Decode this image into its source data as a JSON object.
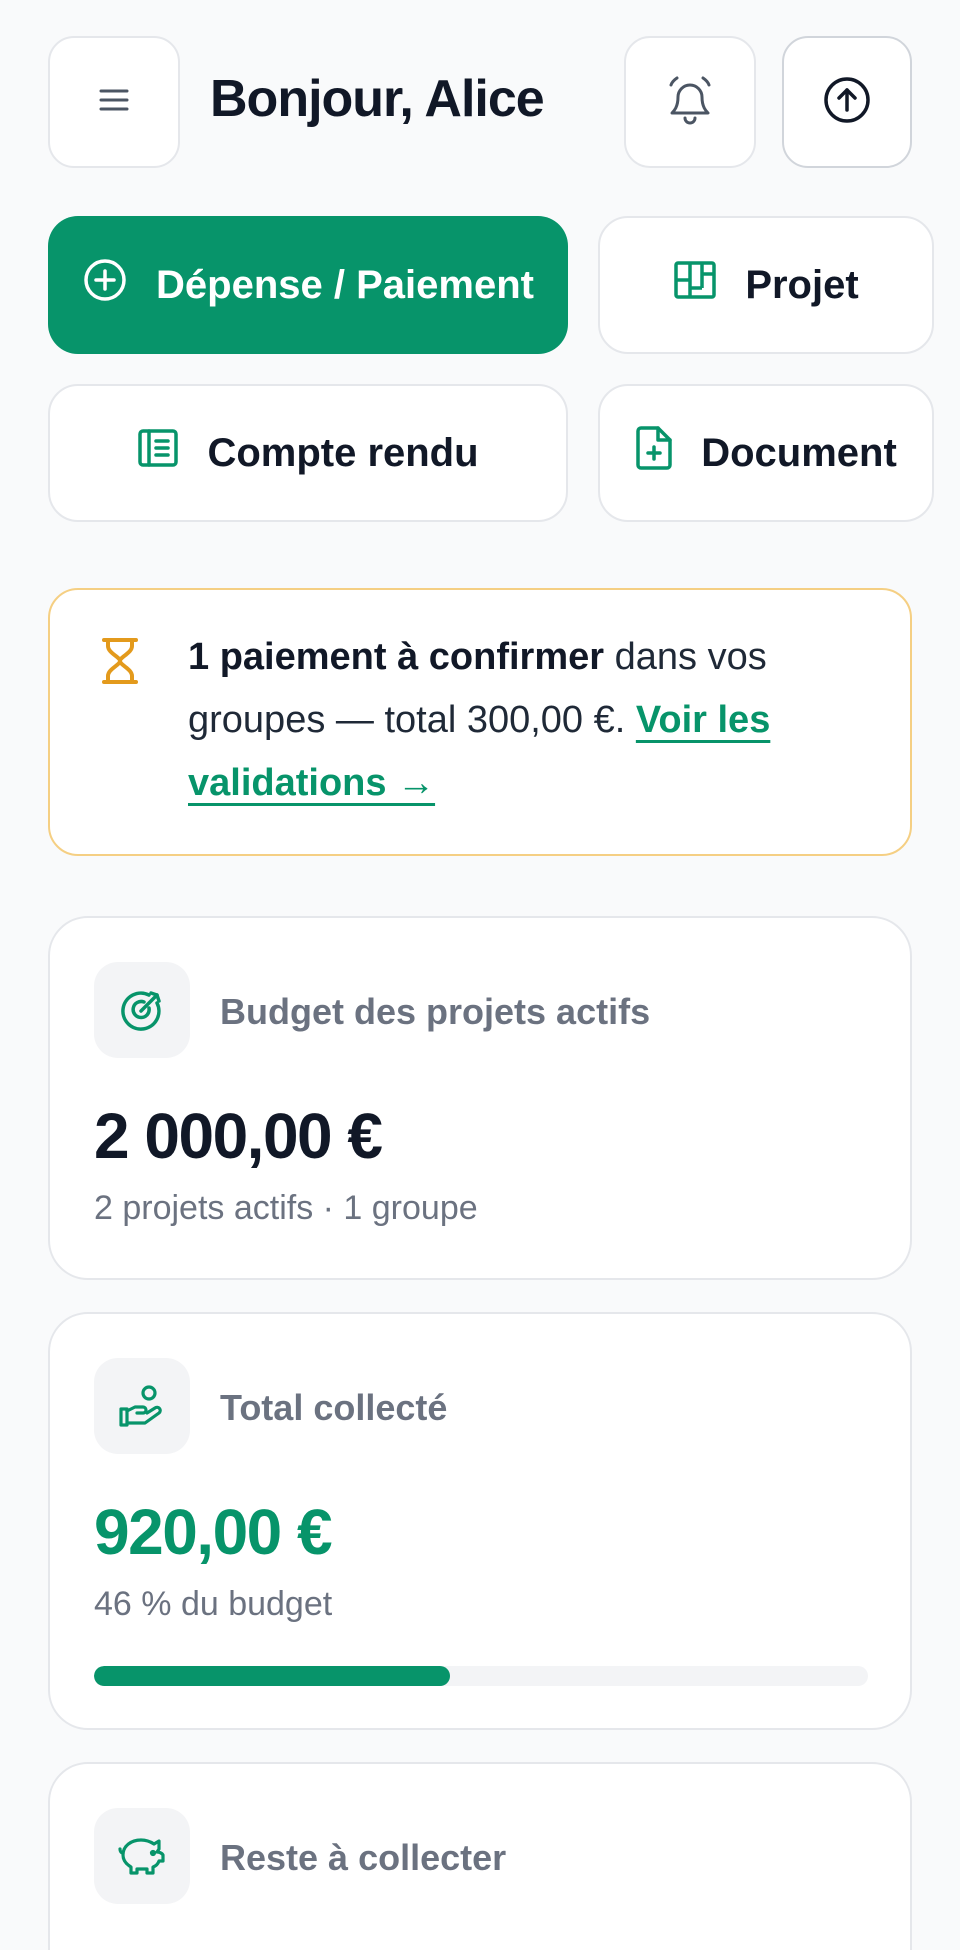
{
  "header": {
    "greeting": "Bonjour, Alice",
    "icons": {
      "menu": "menu-icon",
      "bell": "bell-icon",
      "upload": "upload-icon"
    }
  },
  "actions": {
    "expense_label": "Dépense / Paiement",
    "project_label": "Projet",
    "report_label": "Compte rendu",
    "document_label": "Document"
  },
  "alert": {
    "strong": "1 paiement à confirmer",
    "text": " dans vos groupes — total 300,00 €. ",
    "link": "Voir les validations →"
  },
  "cards": {
    "budget": {
      "title": "Budget des projets actifs",
      "value": "2 000,00 €",
      "subtitle": "2 projets actifs · 1 groupe"
    },
    "collected": {
      "title": "Total collecté",
      "value": "920,00 €",
      "subtitle": "46 % du budget",
      "progress_percent": 46
    },
    "remaining": {
      "title": "Reste à collecter"
    }
  },
  "colors": {
    "accent": "#07946a",
    "warning": "#e39a1c",
    "warning_border": "#f5cf83",
    "text_dark": "#111827",
    "text_muted": "#6b7280"
  }
}
